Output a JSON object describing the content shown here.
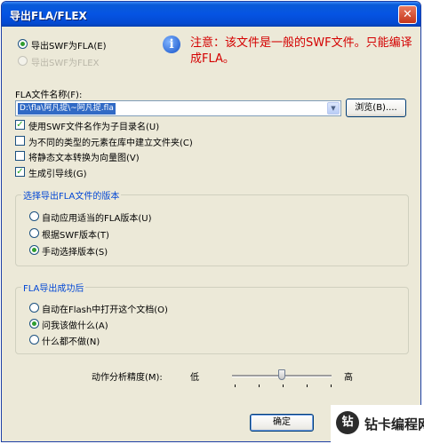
{
  "window": {
    "title": "导出FLA/FLEX",
    "close_glyph": "✕"
  },
  "export_options": [
    {
      "label": "导出SWF为FLA(E)",
      "selected": true,
      "enabled": true
    },
    {
      "label": "导出SWF为FLEX",
      "selected": false,
      "enabled": false
    }
  ],
  "notice": "注意：该文件是一般的SWF文件。只能编译成FLA。",
  "info_icon_glyph": "i",
  "fla_name": {
    "label": "FLA文件名称(F):",
    "value": "D:\\fla\\阿凡提\\~阿凡提.fla",
    "combo_arrow": "▼",
    "browse_label": "浏览(B)...."
  },
  "checkboxes": [
    {
      "label": "使用SWF文件名作为子目录名(U)",
      "checked": true
    },
    {
      "label": "为不同的类型的元素在库中建立文件夹(C)",
      "checked": false
    },
    {
      "label": "将静态文本转换为向量图(V)",
      "checked": false
    },
    {
      "label": "生成引导线(G)",
      "checked": true
    }
  ],
  "version_group": {
    "title": "选择导出FLA文件的版本",
    "options": [
      {
        "label": "自动应用适当的FLA版本(U)",
        "selected": false
      },
      {
        "label": "根据SWF版本(T)",
        "selected": false
      },
      {
        "label": "手动选择版本(S)",
        "selected": true
      }
    ]
  },
  "after_group": {
    "title": "FLA导出成功后",
    "options": [
      {
        "label": "自动在Flash中打开这个文档(O)",
        "selected": false
      },
      {
        "label": "问我该做什么(A)",
        "selected": true
      },
      {
        "label": "什么都不做(N)",
        "selected": false
      }
    ]
  },
  "precision": {
    "label": "动作分析精度(M):",
    "low": "低",
    "high": "高",
    "level": 0.5
  },
  "ok_label": "确定",
  "watermark": {
    "logo": "钻",
    "text": "钻卡编程网"
  }
}
